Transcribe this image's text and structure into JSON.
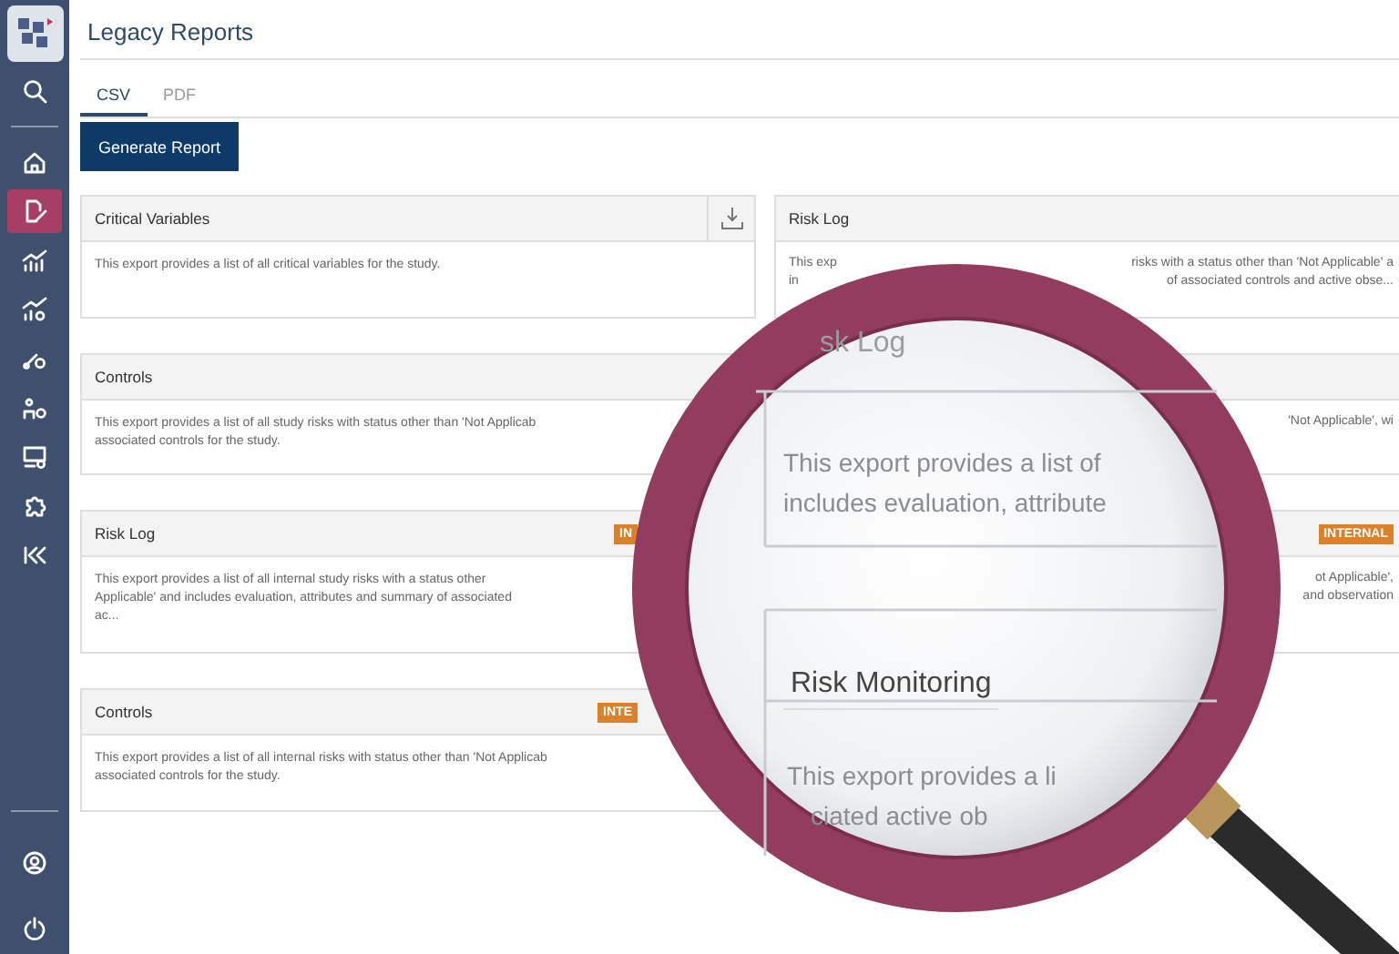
{
  "sidebar": {
    "top_items": [
      {
        "selected": false
      },
      {
        "selected": false
      },
      {
        "selected": true
      },
      {
        "selected": false
      },
      {
        "selected": false
      },
      {
        "selected": false
      },
      {
        "selected": false
      },
      {
        "selected": false
      },
      {
        "selected": false
      },
      {
        "selected": false
      }
    ],
    "bottom_items": [
      {
        "selected": false
      },
      {
        "selected": false
      }
    ]
  },
  "page": {
    "title": "Legacy Reports"
  },
  "tabs": [
    {
      "label": "CSV",
      "selected": true
    },
    {
      "label": "PDF",
      "selected": false
    }
  ],
  "generate_button": "Generate Report",
  "left_cards": [
    {
      "kind": "download",
      "title": "Critical Variables",
      "lines": [
        "This export provides a list of all critical variables for the study."
      ]
    },
    {
      "kind": "plain",
      "title": "Controls",
      "lines": [
        "This export provides a list of all study risks with status other than 'Not Applicab",
        "associated controls for the study."
      ]
    },
    {
      "kind": "badge",
      "title": "Risk Log",
      "badge": "IN",
      "lines": [
        "This export provides a list of all internal study risks with a status other",
        "Applicable' and includes evaluation, attributes and summary of associated",
        "ac..."
      ]
    },
    {
      "kind": "badge",
      "title": "Controls",
      "badge": "INTE",
      "lines": [
        "This export provides a list of all internal risks with status other than 'Not Applicab",
        "associated controls for the study."
      ]
    }
  ],
  "right_cards": [
    {
      "kind": "plain",
      "title": "Risk Log",
      "lines": [
        [
          "This exp",
          "risks with a status other than 'Not Applicable' a"
        ],
        [
          "in",
          "of associated controls and active obse..."
        ]
      ]
    },
    {
      "kind": "plain",
      "lines": [
        [
          "'Not Applicable', wi"
        ]
      ]
    },
    {
      "kind": "badge",
      "badge": "INTERNAL",
      "lines": [
        [
          "ot Applicable',"
        ],
        [
          "and observation"
        ]
      ]
    }
  ],
  "magnifier": {
    "texts": [
      {
        "kind": "faded",
        "text": "sk Log"
      },
      {
        "kind": "body",
        "text": "This export provides a list of"
      },
      {
        "kind": "body",
        "text": "includes evaluation, attribute"
      },
      {
        "kind": "title",
        "text": "Risk Monitoring"
      },
      {
        "kind": "body",
        "text": "This export provides a li"
      },
      {
        "kind": "body",
        "text": "ciated active ob"
      }
    ]
  }
}
